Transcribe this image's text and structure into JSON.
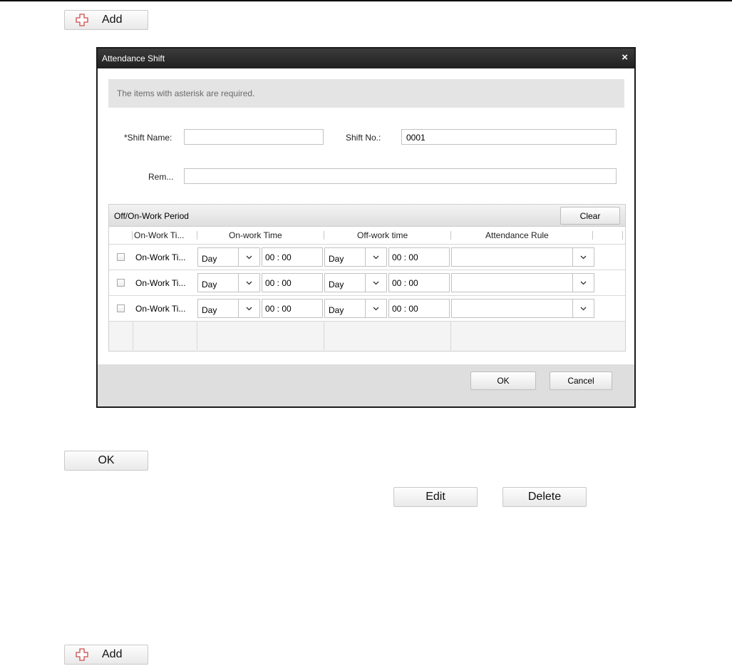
{
  "top_add_button": {
    "label": "Add"
  },
  "dialog": {
    "title": "Attendance Shift",
    "close_glyph": "×",
    "notice": "The items with asterisk are required.",
    "fields": {
      "shift_name_label": "*Shift Name:",
      "shift_name_value": "",
      "shift_no_label": "Shift No.:",
      "shift_no_value": "0001",
      "remark_label": "Rem...",
      "remark_value": ""
    },
    "period": {
      "title": "Off/On-Work Period",
      "clear_label": "Clear",
      "columns": [
        "On-Work Ti...",
        "On-work Time",
        "Off-work time",
        "Attendance Rule"
      ],
      "rows": [
        {
          "label": "On-Work Ti...",
          "on_day": "Day",
          "on_time": "00 : 00",
          "off_day": "Day",
          "off_time": "00 : 00",
          "rule": ""
        },
        {
          "label": "On-Work Ti...",
          "on_day": "Day",
          "on_time": "00 : 00",
          "off_day": "Day",
          "off_time": "00 : 00",
          "rule": ""
        },
        {
          "label": "On-Work Ti...",
          "on_day": "Day",
          "on_time": "00 : 00",
          "off_day": "Day",
          "off_time": "00 : 00",
          "rule": ""
        }
      ]
    },
    "ok_label": "OK",
    "cancel_label": "Cancel"
  },
  "ok_button": {
    "label": "OK"
  },
  "edit_button": {
    "label": "Edit"
  },
  "delete_button": {
    "label": "Delete"
  },
  "bottom_add_button": {
    "label": "Add"
  },
  "icons": {
    "add": "plus-icon",
    "dropdown": "chevron-down-icon",
    "close": "close-icon"
  },
  "colors": {
    "titlebar": "#2b2b2b",
    "add_icon": "#d04a4a"
  }
}
